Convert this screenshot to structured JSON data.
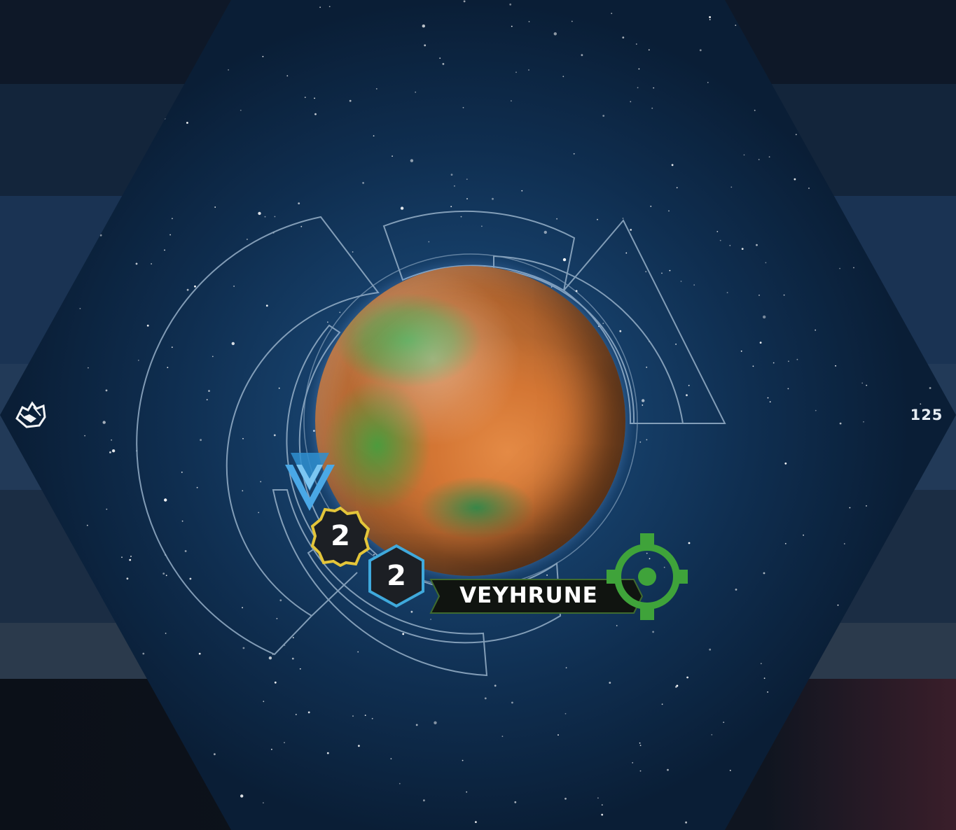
{
  "tile": {
    "number": "125",
    "faction_icon": "mentak-faction-icon",
    "background_color": "#163f69"
  },
  "planet": {
    "name": "VEYHRUNE",
    "resources": "2",
    "influence": "2",
    "trait_icon": "blue-chevron-trait-icon",
    "tech_skip_icon": "green-biotic-skip-icon",
    "resources_color": "#e3c53a",
    "influence_color": "#3fa9dc",
    "skip_color": "#3fa33a"
  }
}
